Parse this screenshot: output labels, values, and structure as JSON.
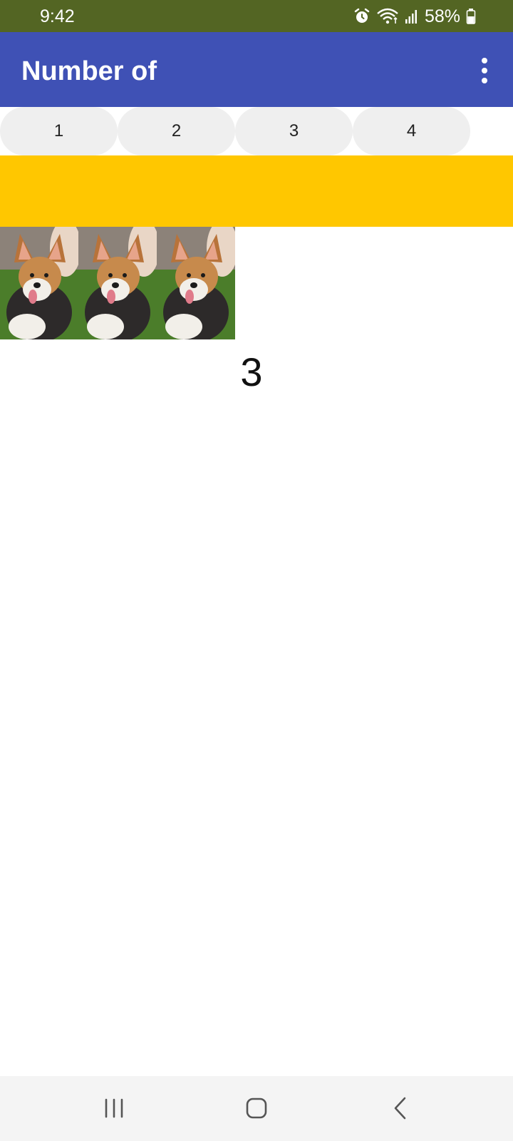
{
  "status_bar": {
    "time": "9:42",
    "battery": "58%",
    "icons": [
      "alarm-icon",
      "wifi-icon",
      "signal-icon",
      "battery-icon"
    ],
    "background": "#536523"
  },
  "app_bar": {
    "title": "Number of",
    "background": "#3f51b5",
    "menu_icon": "overflow-menu-icon"
  },
  "tabs": [
    {
      "label": "1"
    },
    {
      "label": "2"
    },
    {
      "label": "3"
    },
    {
      "label": "4"
    }
  ],
  "banner": {
    "color": "#ffc700"
  },
  "photos": {
    "count": 3,
    "subject": "corgi dog"
  },
  "counter": {
    "value": "3"
  },
  "nav_bar": {
    "icons": [
      "recent-apps-icon",
      "home-icon",
      "back-icon"
    ]
  }
}
